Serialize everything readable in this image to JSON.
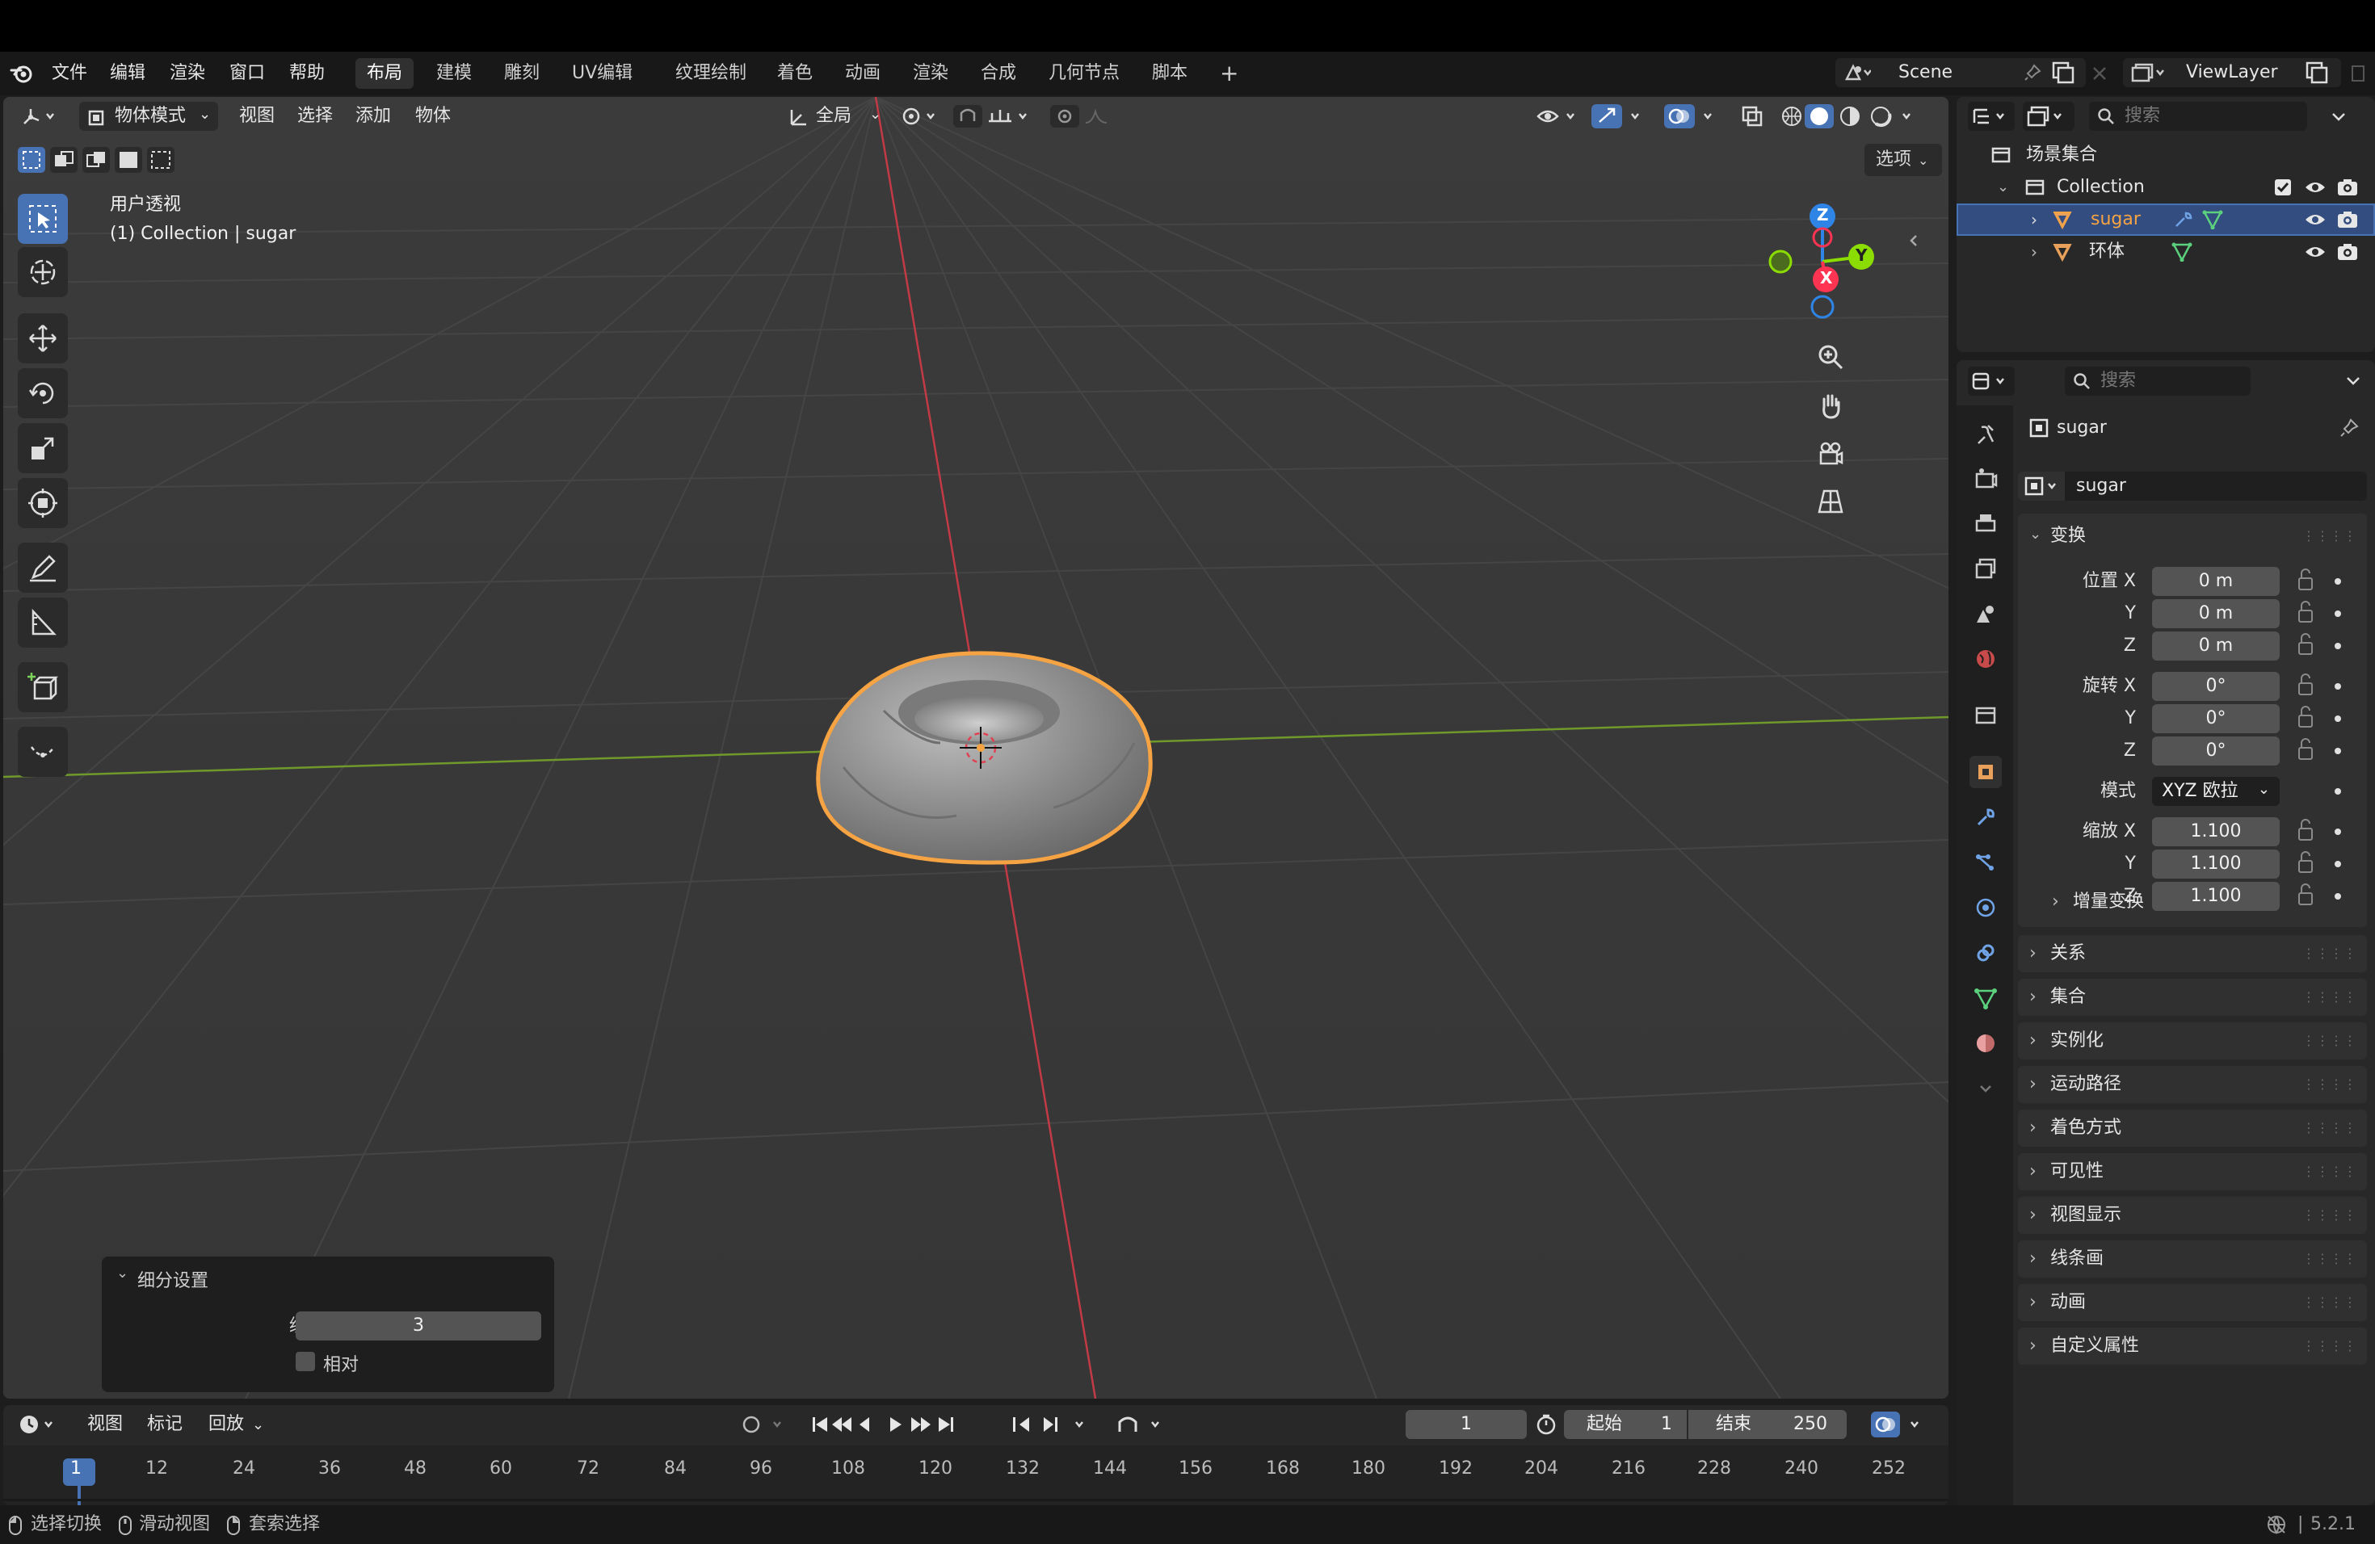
{
  "menubar": {
    "file": "文件",
    "edit": "编辑",
    "render": "渲染",
    "window": "窗口",
    "help": "帮助",
    "workspaces": [
      "布局",
      "建模",
      "雕刻",
      "UV编辑",
      "纹理绘制",
      "着色",
      "动画",
      "渲染",
      "合成",
      "几何节点",
      "脚本"
    ],
    "active_workspace": "布局",
    "scene": "Scene",
    "view_layer": "ViewLayer"
  },
  "viewport_header": {
    "mode": "物体模式",
    "menus": [
      "视图",
      "选择",
      "添加",
      "物体"
    ],
    "orientation": "全局",
    "options": "选项"
  },
  "viewport": {
    "view_name": "用户透视",
    "object_info": "(1) Collection | sugar",
    "gizmo": {
      "x": "X",
      "y": "Y",
      "z": "Z"
    }
  },
  "redo_panel": {
    "title": "细分设置",
    "level_label": "级别",
    "level_value": "3",
    "relative_label": "相对"
  },
  "outliner": {
    "search_placeholder": "搜索",
    "scene_collection": "场景集合",
    "collection": "Collection",
    "objects": [
      {
        "name": "sugar",
        "selected": true
      },
      {
        "name": "环体",
        "selected": false
      }
    ]
  },
  "properties": {
    "search_placeholder": "搜索",
    "object_name": "sugar",
    "datablock_name": "sugar",
    "transform": {
      "title": "变换",
      "location_label": "位置 X",
      "y": "Y",
      "z": "Z",
      "location": [
        "0 m",
        "0 m",
        "0 m"
      ],
      "rotation_label": "旋转 X",
      "rotation": [
        "0°",
        "0°",
        "0°"
      ],
      "mode_label": "模式",
      "mode_value": "XYZ 欧拉",
      "scale_label": "缩放 X",
      "scale": [
        "1.100",
        "1.100",
        "1.100"
      ],
      "delta": "增量变换"
    },
    "panels": [
      "关系",
      "集合",
      "实例化",
      "运动路径",
      "着色方式",
      "可见性",
      "视图显示",
      "线条画",
      "动画",
      "自定义属性"
    ]
  },
  "timeline": {
    "menus": [
      "视图",
      "标记"
    ],
    "playback": "回放",
    "current_frame": "1",
    "start_label": "起始",
    "start": "1",
    "end_label": "结束",
    "end": "250",
    "ruler": [
      "1",
      "12",
      "24",
      "36",
      "48",
      "60",
      "72",
      "84",
      "96",
      "108",
      "120",
      "132",
      "144",
      "156",
      "168",
      "180",
      "192",
      "204",
      "216",
      "228",
      "240",
      "252"
    ]
  },
  "statusbar": {
    "items": [
      "选择切换",
      "滑动视图",
      "套索选择"
    ],
    "version": "5.2.1"
  },
  "colors": {
    "accent": "#4772b3",
    "selection_outline": "#f5a343",
    "x_axis": "#ff3352",
    "y_axis": "#8bdc00",
    "z_axis": "#2f85e6"
  }
}
